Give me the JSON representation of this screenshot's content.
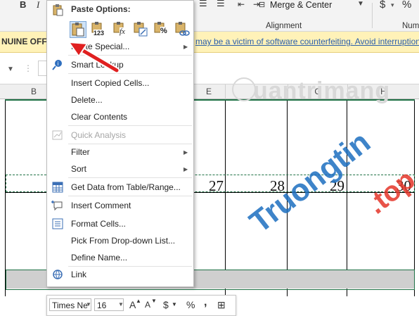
{
  "ribbon": {
    "bold": "B",
    "italic": "I",
    "merge_center": "Merge & Center",
    "alignment_group": "Alignment",
    "number_group": "Num",
    "currency": "$",
    "percent": "%"
  },
  "warning_bar": {
    "left_text": "NUINE OFFIC",
    "right_text": "may be a victim of software counterfeiting. Avoid interruption"
  },
  "columns": [
    "B",
    "E",
    "G",
    "H"
  ],
  "row_values": [
    "27",
    "28",
    "29",
    "30"
  ],
  "context_menu": {
    "paste_options_label": "Paste Options:",
    "paste_special": "Paste Special...",
    "smart_lookup": "Smart Lookup",
    "insert_copied_cells": "Insert Copied Cells...",
    "delete": "Delete...",
    "clear_contents": "Clear Contents",
    "quick_analysis": "Quick Analysis",
    "filter": "Filter",
    "sort": "Sort",
    "get_data": "Get Data from Table/Range...",
    "insert_comment": "Insert Comment",
    "format_cells": "Format Cells...",
    "pick_from_list": "Pick From Drop-down List...",
    "define_name": "Define Name...",
    "link": "Link",
    "paste_icons": [
      "paste-icon",
      "paste-values-icon",
      "paste-formulas-icon",
      "transpose-icon",
      "paste-formatting-icon",
      "paste-link-icon"
    ],
    "paste_123": "123",
    "paste_fx": "fx",
    "paste_pct": "%"
  },
  "mini_toolbar": {
    "font_name": "Times Ne",
    "font_size": "16",
    "grow": "A",
    "shrink": "A",
    "currency": "$",
    "percent": "%",
    "comma": ","
  },
  "watermarks": {
    "quantrimang": "uantrimang",
    "truongtin": "Truongtin",
    "top": ".top"
  },
  "colors": {
    "accent_green": "#1e7145",
    "arrow_red": "#e02020",
    "warning_bg": "#fff2b8",
    "link_blue": "#2b5fab"
  }
}
